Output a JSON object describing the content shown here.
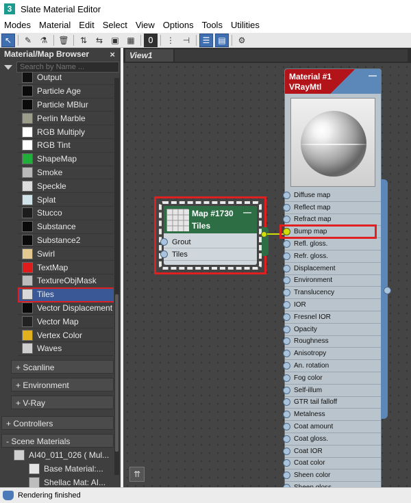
{
  "window": {
    "title": "Slate Material Editor",
    "app_icon_glyph": "3"
  },
  "menu": [
    "Modes",
    "Material",
    "Edit",
    "Select",
    "View",
    "Options",
    "Tools",
    "Utilities"
  ],
  "toolbar": {
    "buttons": [
      {
        "name": "select-tool",
        "glyph": "↖",
        "active": true
      },
      {
        "name": "pick-material",
        "glyph": "✎"
      },
      {
        "name": "put-to-scene",
        "glyph": "⚗"
      },
      {
        "name": "delete-selected",
        "glyph": "🗑"
      },
      {
        "name": "move-children",
        "glyph": "⇅"
      },
      {
        "name": "hide-unused-slots",
        "glyph": "⇆"
      },
      {
        "name": "show-shaded-material",
        "glyph": "▣"
      },
      {
        "name": "show-background",
        "glyph": "▦"
      },
      {
        "name": "material-id",
        "glyph": "0",
        "dark": true
      },
      {
        "name": "lay-out-all",
        "glyph": "⋮"
      },
      {
        "name": "lay-out-children",
        "glyph": "⊣"
      },
      {
        "name": "material-map-browser",
        "glyph": "☰",
        "active": true
      },
      {
        "name": "parameter-editor",
        "glyph": "▤",
        "active": true
      },
      {
        "name": "select-by-material",
        "glyph": "⚙"
      }
    ]
  },
  "browser": {
    "header": "Material/Map Browser",
    "close_glyph": "×",
    "search_placeholder": "Search by Name ...",
    "maps": [
      {
        "label": "Output",
        "swatch": "#111111"
      },
      {
        "label": "Particle Age",
        "swatch": "#0a0a0a"
      },
      {
        "label": "Particle MBlur",
        "swatch": "#0a0a0a"
      },
      {
        "label": "Perlin Marble",
        "swatch": "#9d9d8c"
      },
      {
        "label": "RGB Multiply",
        "swatch": "#ffffff"
      },
      {
        "label": "RGB Tint",
        "swatch": "#ffffff"
      },
      {
        "label": "ShapeMap",
        "swatch": "#1fae3a"
      },
      {
        "label": "Smoke",
        "swatch": "#b9b9b9"
      },
      {
        "label": "Speckle",
        "swatch": "#dcdcdc"
      },
      {
        "label": "Splat",
        "swatch": "#cfe3e8"
      },
      {
        "label": "Stucco",
        "swatch": "#1c1c1c"
      },
      {
        "label": "Substance",
        "swatch": "#0a0a0a"
      },
      {
        "label": "Substance2",
        "swatch": "#0a0a0a"
      },
      {
        "label": "Swirl",
        "swatch": "#e3c88f"
      },
      {
        "label": "TextMap",
        "swatch": "#e01b1b"
      },
      {
        "label": "TextureObjMask",
        "swatch": "#bdbdbd"
      },
      {
        "label": "Tiles",
        "swatch": "#d9d9d9",
        "selected": true
      },
      {
        "label": "Vector Displacement",
        "swatch": "#0a0a0a"
      },
      {
        "label": "Vector Map",
        "swatch": "#222222"
      },
      {
        "label": "Vertex Color",
        "swatch": "#e2b21e"
      },
      {
        "label": "Waves",
        "swatch": "#cfcfcf"
      }
    ],
    "groups": [
      "+ Scanline",
      "+ Environment",
      "+ V-Ray"
    ],
    "controllers": "+ Controllers",
    "scene_materials": "- Scene Materials",
    "scene_items": [
      "AI40_011_026  ( Mul...",
      "Base Material:...",
      "Shellac Mat: AI..."
    ]
  },
  "view": {
    "tab": "View1"
  },
  "map_node": {
    "name": "Map #1730",
    "type": "Tiles",
    "collapse": "—",
    "slots": [
      "Grout",
      "Tiles"
    ]
  },
  "material_node": {
    "name": "Material #1",
    "type": "VRayMtl",
    "collapse": "—",
    "slots": [
      "Diffuse map",
      "Reflect map",
      "Refract map",
      "Bump map",
      "Refl. gloss.",
      "Refr. gloss.",
      "Displacement",
      "Environment",
      "Translucency",
      "IOR",
      "Fresnel IOR",
      "Opacity",
      "Roughness",
      "Anisotropy",
      "An. rotation",
      "Fog color",
      "Self-illum",
      "GTR tail falloff",
      "Metalness",
      "Coat amount",
      "Coat gloss.",
      "Coat IOR",
      "Coat color",
      "Sheen color",
      "Sheen gloss."
    ],
    "connected_slot": "Bump map"
  },
  "status": {
    "text": "Rendering finished"
  },
  "colors": {
    "selection": "#3a5896",
    "highlight": "#e02020",
    "map_header": "#2d6e45",
    "material_header": "#b3141a",
    "wire": "#d2e000"
  }
}
